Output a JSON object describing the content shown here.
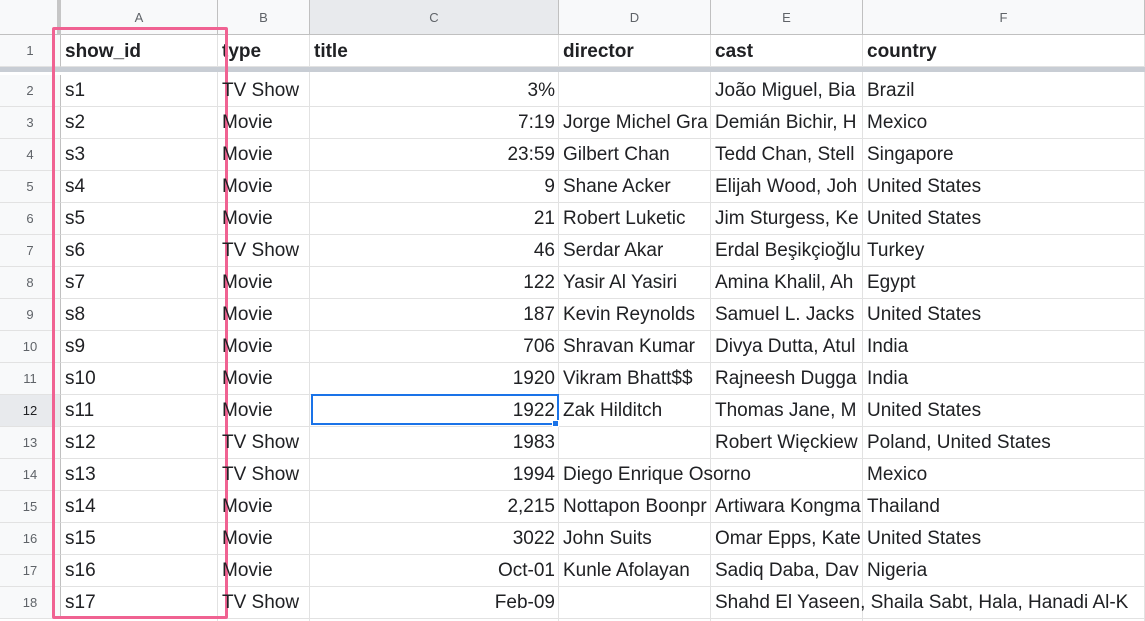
{
  "column_headers": [
    "A",
    "B",
    "C",
    "D",
    "E",
    "F"
  ],
  "row_numbers": [
    "1",
    "2",
    "3",
    "4",
    "5",
    "6",
    "7",
    "8",
    "9",
    "10",
    "11",
    "12",
    "13",
    "14",
    "15",
    "16",
    "17",
    "18"
  ],
  "header_row": [
    "show_id",
    "type",
    "title",
    "director",
    "cast",
    "country"
  ],
  "rows": [
    [
      "s1",
      "TV Show",
      "3%",
      "",
      "João Miguel, Bia",
      "Brazil"
    ],
    [
      "s2",
      "Movie",
      "7:19",
      "Jorge Michel Gra",
      "Demián Bichir, H",
      "Mexico"
    ],
    [
      "s3",
      "Movie",
      "23:59",
      "Gilbert Chan",
      "Tedd Chan, Stell",
      "Singapore"
    ],
    [
      "s4",
      "Movie",
      "9",
      "Shane Acker",
      "Elijah Wood, Joh",
      "United States"
    ],
    [
      "s5",
      "Movie",
      "21",
      "Robert Luketic",
      "Jim Sturgess, Ke",
      "United States"
    ],
    [
      "s6",
      "TV Show",
      "46",
      "Serdar Akar",
      "Erdal Beşikçioğlu",
      "Turkey"
    ],
    [
      "s7",
      "Movie",
      "122",
      "Yasir Al Yasiri",
      "Amina Khalil, Ah",
      "Egypt"
    ],
    [
      "s8",
      "Movie",
      "187",
      "Kevin Reynolds",
      "Samuel L. Jacks",
      "United States"
    ],
    [
      "s9",
      "Movie",
      "706",
      "Shravan Kumar",
      "Divya Dutta, Atul",
      "India"
    ],
    [
      "s10",
      "Movie",
      "1920",
      "Vikram Bhatt$$",
      "Rajneesh Dugga",
      "India"
    ],
    [
      "s11",
      "Movie",
      "1922",
      "Zak Hilditch",
      "Thomas Jane, M",
      "United States"
    ],
    [
      "s12",
      "TV Show",
      "1983",
      "",
      "Robert Więckiew",
      "Poland, United States"
    ],
    [
      "s13",
      "TV Show",
      "1994",
      "Diego Enrique Osorno",
      "",
      "Mexico"
    ],
    [
      "s14",
      "Movie",
      "2,215",
      "Nottapon Boonpr",
      "Artiwara Kongma",
      "Thailand"
    ],
    [
      "s15",
      "Movie",
      "3022",
      "John Suits",
      "Omar Epps, Kate",
      "United States"
    ],
    [
      "s16",
      "Movie",
      "Oct-01",
      "Kunle Afolayan",
      "Sadiq Daba, Dav",
      "Nigeria"
    ],
    [
      "s17",
      "TV Show",
      "Feb-09",
      "",
      "Shahd El Yaseen, Shaila Sabt, Hala, Hanadi Al-K",
      ""
    ]
  ],
  "selected_cell": "C12",
  "highlight_color": "#f06292",
  "selection_color": "#1a73e8"
}
